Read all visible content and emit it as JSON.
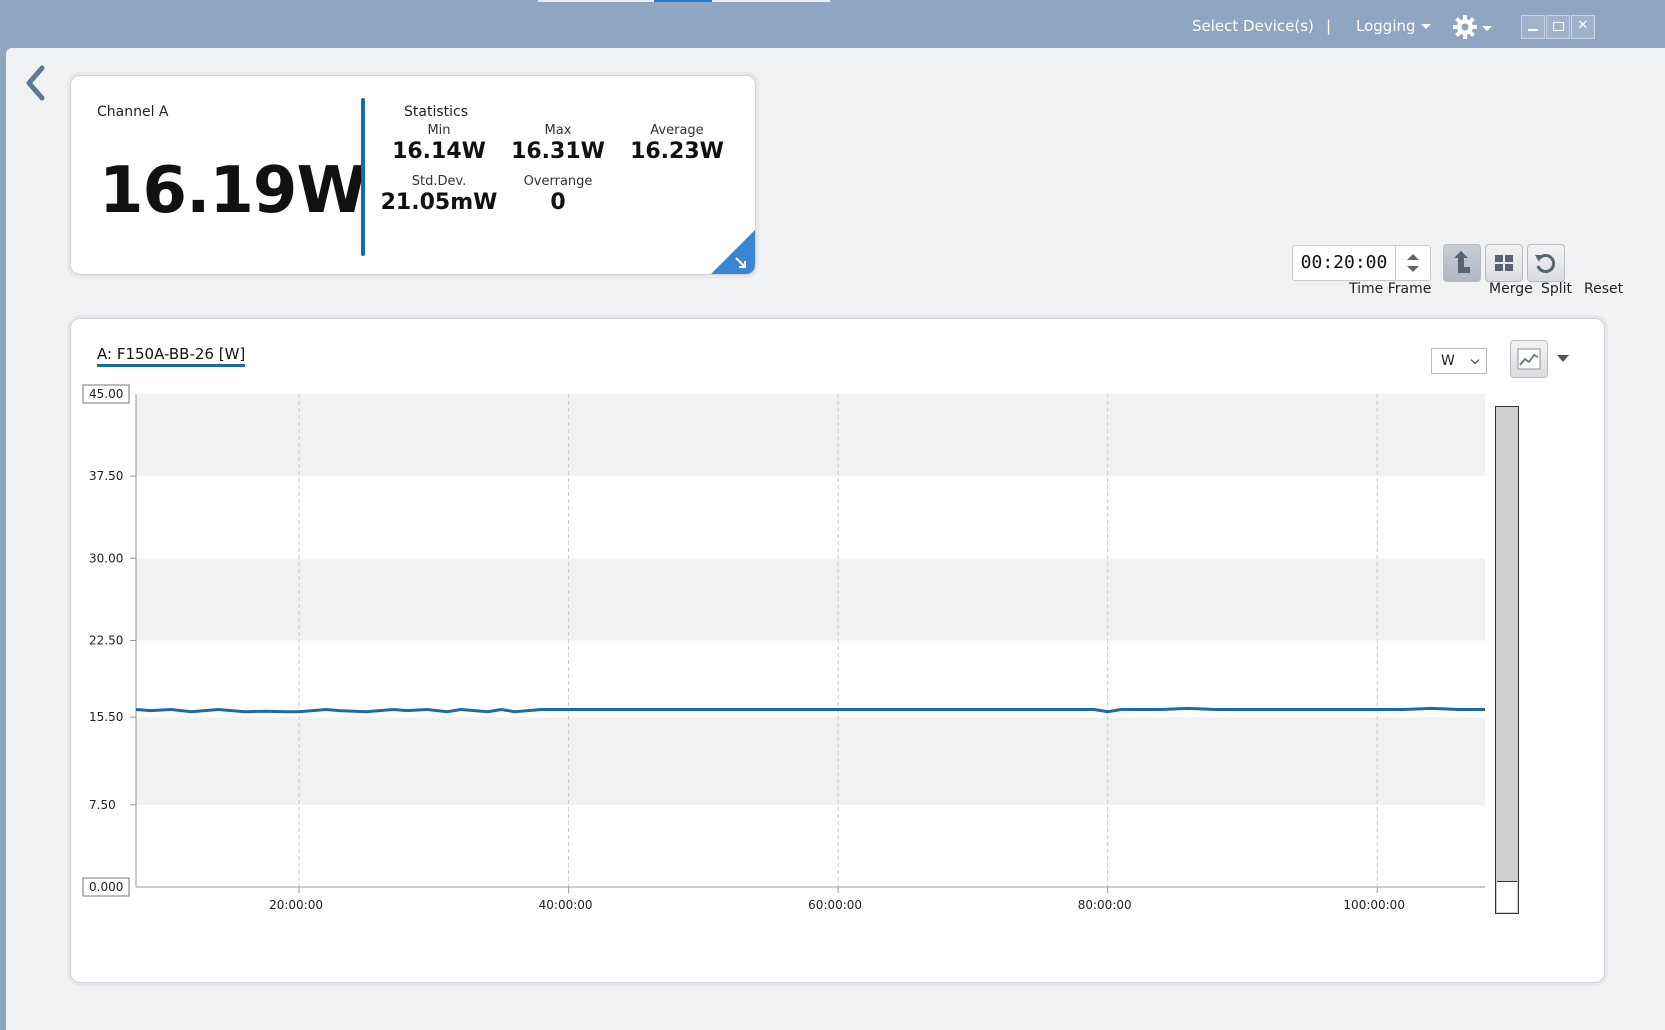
{
  "topbar": {
    "select_devices": "Select Device(s)",
    "separator": "|",
    "logging": "Logging",
    "window_buttons": [
      "minimize",
      "restore",
      "close"
    ]
  },
  "channel": {
    "label": "Channel A",
    "value": "16.19W",
    "statistics_title": "Statistics",
    "stats": [
      {
        "label": "Min",
        "value": "16.14W"
      },
      {
        "label": "Max",
        "value": "16.31W"
      },
      {
        "label": "Average",
        "value": "16.23W"
      },
      {
        "label": "Std.Dev.",
        "value": "21.05mW"
      },
      {
        "label": "Overrange",
        "value": "0"
      }
    ]
  },
  "controls": {
    "time_frame_label": "Time Frame",
    "time_frame_value": "00:20:00",
    "merge_label": "Merge",
    "split_label": "Split",
    "reset_label": "Reset"
  },
  "chart_panel": {
    "title": "A: F150A-BB-26 [W]",
    "unit": "W"
  },
  "colors": {
    "series": "#1b6ba5",
    "accent": "#2f78c4"
  },
  "chart_data": {
    "type": "line",
    "title": "A: F150A-BB-26 [W]",
    "xlabel": "",
    "ylabel": "",
    "ylim": [
      0,
      45
    ],
    "y_ticks": [
      "0.000",
      "7.50",
      "15.50",
      "22.50",
      "30.00",
      "37.50",
      "45.00"
    ],
    "y_tick_values": [
      0,
      7.5,
      15.5,
      22.5,
      30,
      37.5,
      45
    ],
    "x_ticks": [
      "20:00:00",
      "40:00:00",
      "60:00:00",
      "80:00:00",
      "100:00:00"
    ],
    "x_tick_hours": [
      20,
      40,
      60,
      80,
      100
    ],
    "xlim_hours": [
      7.9,
      108
    ],
    "grid": true,
    "series": [
      {
        "x_hours": [
          7.9,
          9,
          10.5,
          12,
          13,
          14,
          15,
          16,
          17.5,
          19,
          20,
          21,
          22,
          23,
          25,
          27,
          28,
          29.5,
          31,
          32,
          33,
          34,
          35,
          36,
          37,
          38,
          40,
          45,
          50,
          55,
          60,
          65,
          70,
          75,
          79,
          80,
          81,
          84,
          86,
          88,
          92,
          96,
          100,
          102,
          104,
          106,
          108
        ],
        "values": [
          16.2,
          16.1,
          16.2,
          16.0,
          16.1,
          16.2,
          16.1,
          16.0,
          16.05,
          16.0,
          16.0,
          16.1,
          16.2,
          16.1,
          16.0,
          16.2,
          16.1,
          16.2,
          16.0,
          16.2,
          16.1,
          16.0,
          16.2,
          16.0,
          16.1,
          16.2,
          16.2,
          16.2,
          16.2,
          16.2,
          16.2,
          16.2,
          16.2,
          16.2,
          16.2,
          16.0,
          16.2,
          16.2,
          16.3,
          16.2,
          16.2,
          16.2,
          16.2,
          16.2,
          16.3,
          16.2,
          16.2
        ]
      }
    ]
  }
}
